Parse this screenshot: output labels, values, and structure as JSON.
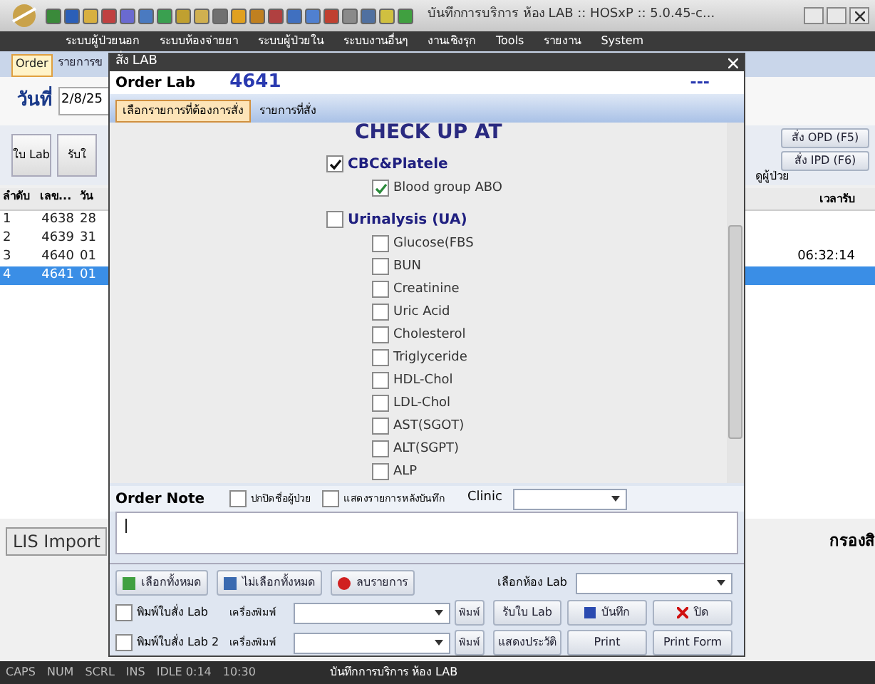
{
  "window": {
    "title": "บันทึกการบริการ ห้อง LAB :: HOSxP :: 5.0.45-c..."
  },
  "menu": [
    "ระบบผู้ป่วยนอก",
    "ระบบห้องจ่ายยา",
    "ระบบผู้ป่วยใน",
    "ระบบงานอื่นๆ",
    "งานเชิงรุก",
    "Tools",
    "รายงาน",
    "System"
  ],
  "main_tabs": [
    {
      "label": "Order",
      "selected": true
    },
    {
      "label": "รายการข",
      "selected": false
    }
  ],
  "date": {
    "label": "วันที่",
    "value": "2/8/25"
  },
  "toolbar": [
    "ใบ Lab",
    "รับใ"
  ],
  "right_buttons": [
    "สั่ง OPD (F5)",
    "สั่ง IPD (F6)"
  ],
  "right_label": "ดูผู้ป่วย",
  "table": {
    "columns": [
      "ลำดับ",
      "เลข...",
      "วัน"
    ],
    "last_column": "เวลารับ",
    "rows": [
      {
        "cells": [
          "1",
          "4638",
          "28"
        ],
        "time": "",
        "selected": false
      },
      {
        "cells": [
          "2",
          "4639",
          "31"
        ],
        "time": "",
        "selected": false
      },
      {
        "cells": [
          "3",
          "4640",
          "01"
        ],
        "time": "06:32:14",
        "selected": false
      },
      {
        "cells": [
          "4",
          "4641",
          "01"
        ],
        "time": "",
        "selected": true
      }
    ]
  },
  "lis_button": "LIS Import",
  "filter_label": "กรองสิ",
  "status_bar": [
    "CAPS",
    "NUM",
    "SCRL",
    "INS",
    "IDLE 0:14",
    "10:30",
    "บันทึกการบริการ ห้อง LAB"
  ],
  "dialog": {
    "title": "สั่ง LAB",
    "order_label": "Order Lab",
    "order_number": "4641",
    "status": "---",
    "tabs": [
      {
        "label": "เลือกรายการที่ต้องการสั่ง",
        "selected": true
      },
      {
        "label": "รายการที่สั่ง",
        "selected": false
      }
    ],
    "heading": "CHECK UP AT",
    "groups": [
      {
        "name": "CBC&Platele",
        "checked": true,
        "items": [
          {
            "name": "Blood group ABO",
            "checked": true
          }
        ]
      },
      {
        "name": "Urinalysis (UA)",
        "checked": false,
        "items": [
          {
            "name": "Glucose(FBS",
            "checked": false
          },
          {
            "name": "BUN",
            "checked": false
          },
          {
            "name": "Creatinine",
            "checked": false
          },
          {
            "name": "Uric Acid",
            "checked": false
          },
          {
            "name": "Cholesterol",
            "checked": false
          },
          {
            "name": "Triglyceride",
            "checked": false
          },
          {
            "name": "HDL-Chol",
            "checked": false
          },
          {
            "name": "LDL-Chol",
            "checked": false
          },
          {
            "name": "AST(SGOT)",
            "checked": false
          },
          {
            "name": "ALT(SGPT)",
            "checked": false
          },
          {
            "name": "ALP",
            "checked": false
          }
        ]
      }
    ],
    "note": {
      "label": "Order Note",
      "hide_name": {
        "label": "ปกปิดชื่อผู้ป่วย",
        "checked": false
      },
      "show_after": {
        "label": "แสดงรายการหลังบันทึก",
        "checked": false
      },
      "clinic_label": "Clinic"
    },
    "select_buttons": [
      "เลือกทั้งหมด",
      "ไม่เลือกทั้งหมด",
      "ลบรายการ"
    ],
    "lab_room_label": "เลือกห้อง Lab",
    "print_rows": [
      {
        "label": "พิมพ์ใบสั่ง Lab",
        "checked": false,
        "printer_label": "เครื่องพิมพ์",
        "button": "พิมพ์"
      },
      {
        "label": "พิมพ์ใบสั่ง Lab 2",
        "checked": false,
        "printer_label": "เครื่องพิมพ์",
        "button": "พิมพ์"
      }
    ],
    "action_buttons": [
      {
        "label": "รับใบ Lab",
        "kind": "plain"
      },
      {
        "label": "บันทึก",
        "kind": "save"
      },
      {
        "label": "ปิด",
        "kind": "close"
      },
      {
        "label": "แสดงประวัติ",
        "kind": "plain"
      },
      {
        "label": "Print",
        "kind": "plain"
      },
      {
        "label": "Print Form",
        "kind": "plain"
      }
    ]
  }
}
